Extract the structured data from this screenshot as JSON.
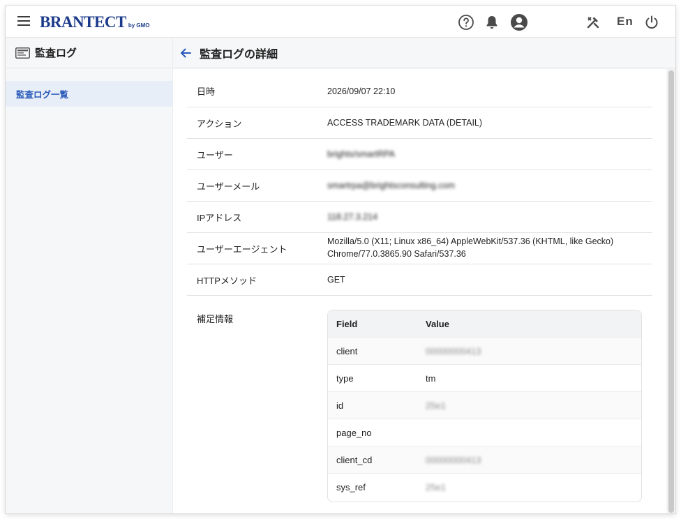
{
  "header": {
    "logo_text": "BRANTECT",
    "logo_sub": "by GMO",
    "lang": "En",
    "icons": [
      "menu-icon",
      "help-icon",
      "bell-icon",
      "account-icon",
      "tools-icon",
      "power-icon"
    ]
  },
  "sidebar": {
    "title": "監査ログ",
    "items": [
      {
        "label": "監査ログ一覧",
        "active": true
      }
    ]
  },
  "main": {
    "title": "監査ログの詳細"
  },
  "details": [
    {
      "label": "日時",
      "value": "2026/09/07 22:10",
      "blurred": false
    },
    {
      "label": "アクション",
      "value": "ACCESS TRADEMARK DATA (DETAIL)",
      "blurred": false
    },
    {
      "label": "ユーザー",
      "value": "brights/smartRPA",
      "blurred": true
    },
    {
      "label": "ユーザーメール",
      "value": "smartrpa@brightsconsulting.com",
      "blurred": true
    },
    {
      "label": "IPアドレス",
      "value": "118.27.3.214",
      "blurred": true
    },
    {
      "label": "ユーザーエージェント",
      "value": "Mozilla/5.0 (X11; Linux x86_64) AppleWebKit/537.36 (KHTML, like Gecko)",
      "value2": "Chrome/77.0.3865.90 Safari/537.36",
      "blurred": false
    },
    {
      "label": "HTTPメソッド",
      "value": "GET",
      "blurred": false
    }
  ],
  "supplement": {
    "label": "補足情報",
    "headers": [
      "Field",
      "Value"
    ],
    "rows": [
      {
        "field": "client",
        "value": "00000000413",
        "blurred": true
      },
      {
        "field": "type",
        "value": "tm",
        "blurred": false
      },
      {
        "field": "id",
        "value": "25e1",
        "blurred": true
      },
      {
        "field": "page_no",
        "value": "",
        "blurred": false
      },
      {
        "field": "client_cd",
        "value": "00000000413",
        "blurred": true
      },
      {
        "field": "sys_ref",
        "value": "25e1",
        "blurred": true
      }
    ]
  },
  "colors": {
    "brand": "#1b3a8a",
    "accent": "#2859b8",
    "sidebar_active_bg": "#e8eef8",
    "page_bg": "#f6f7f9"
  }
}
